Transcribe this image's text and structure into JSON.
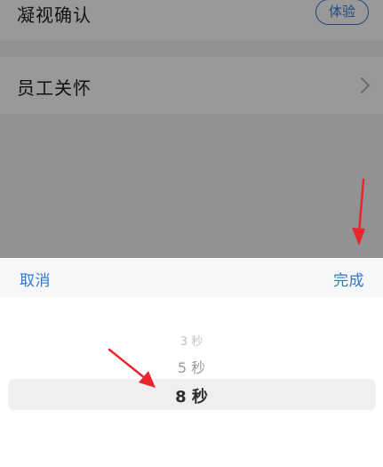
{
  "settings": {
    "gaze_confirm": {
      "label": "凝视确认",
      "button_label": "体验"
    },
    "employee_care": {
      "label": "员工关怀",
      "icon": "chevron-right-icon"
    }
  },
  "picker": {
    "cancel_label": "取消",
    "done_label": "完成",
    "options": [
      "3 秒",
      "5 秒",
      "8 秒"
    ],
    "selected_label": "8 秒"
  },
  "colors": {
    "accent": "#3576c8",
    "annotation_arrow": "#e8262b"
  }
}
